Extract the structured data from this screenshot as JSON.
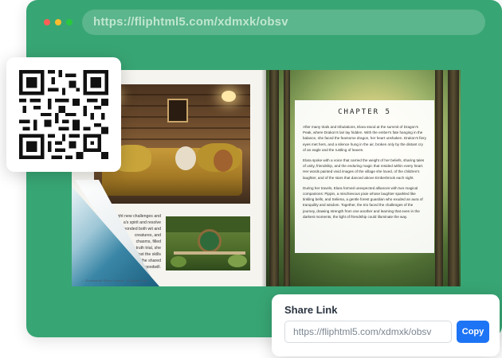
{
  "browser": {
    "url": "https://fliphtml5.com/xdmxk/obsv",
    "dots": [
      "#ff5f57",
      "#febc2e",
      "#28c840"
    ],
    "frame_color": "#38a574"
  },
  "book": {
    "left_page": {
      "text_lines": [
        "ight new challenges and",
        "a's spirit and resolve",
        "bonded both wit and",
        "creatures, and",
        "chasms, filled",
        "truth trial, she",
        "lost the skills",
        "the shared",
        "goodwill."
      ],
      "footer": "— Enchanted Ekorn Forest · Chapter Five"
    },
    "right_page": {
      "chapter_title": "CHAPTER 5",
      "paragraphs": [
        "After many trials and tribulations, Elara stood at the summit of Dragon's Peak, where Drakon's lair lay hidden. With the ember's fate hanging in the balance, she faced the fearsome dragon, her heart unshaken. Drakon's fiery eyes met hers, and a silence hung in the air, broken only by the distant cry of an eagle and the rustling of leaves.",
        "Elara spoke with a voice that carried the weight of her beliefs, sharing tales of unity, friendship, and the enduring magic that resided within every heart. Her words painted vivid images of the village she loved, of the children's laughter, and of the stars that danced above Emberbrook each night.",
        "During her travels, Elara formed unexpected alliances with two magical companions: Pippin, a mischievous pixie whose laughter sparkled like tinkling bells, and Seliena, a gentle forest guardian who exuded an aura of tranquility and wisdom. Together, the trio faced the challenges of the journey, drawing strength from one another and learning that even in the darkest moments, the light of friendship could illuminate the way."
      ]
    }
  },
  "share": {
    "title": "Share Link",
    "link_value": "https://fliphtml5.com/xdmxk/obsv",
    "copy_label": "Copy",
    "button_color": "#1d74f5"
  },
  "qr": {
    "icon": "qr-code-icon"
  }
}
